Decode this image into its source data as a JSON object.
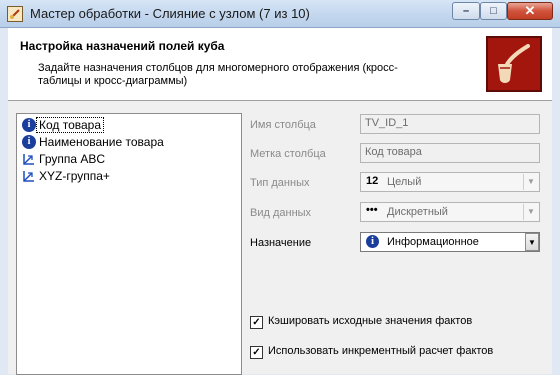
{
  "window": {
    "title": "Мастер обработки - Слияние с узлом (7 из 10)",
    "min_glyph": "–",
    "max_glyph": "□",
    "close_glyph": "✕"
  },
  "header": {
    "title": "Настройка назначений полей куба",
    "description": "Задайте назначения столбцов для многомерного отображения (кросс-таблицы и кросс-диаграммы)"
  },
  "fields_list": [
    {
      "label": "Код товара",
      "icon": "info-icon",
      "selected": true
    },
    {
      "label": "Наименование товара",
      "icon": "info-icon",
      "selected": false
    },
    {
      "label": "Группа ABC",
      "icon": "dimension-icon",
      "selected": false
    },
    {
      "label": "XYZ-группа+",
      "icon": "dimension-icon",
      "selected": false
    }
  ],
  "form": {
    "column_name_label": "Имя столбца",
    "column_name_value": "TV_ID_1",
    "column_caption_label": "Метка столбца",
    "column_caption_value": "Код товара",
    "data_type_label": "Тип данных",
    "data_type_icon": "12",
    "data_type_value": "Целый",
    "data_kind_label": "Вид данных",
    "data_kind_icon": "•••",
    "data_kind_value": "Дискретный",
    "purpose_label": "Назначение",
    "purpose_icon": "i",
    "purpose_value": "Информационное"
  },
  "options": {
    "cache_label": "Кэшировать исходные значения фактов",
    "cache_checked": true,
    "incremental_label": "Использовать инкрементный расчет фактов",
    "incremental_checked": true,
    "check_glyph": "✓"
  },
  "colors": {
    "info_blue": "#1b3e9c",
    "dimension_blue": "#1f4fbf",
    "logo_red": "#a2160e"
  }
}
